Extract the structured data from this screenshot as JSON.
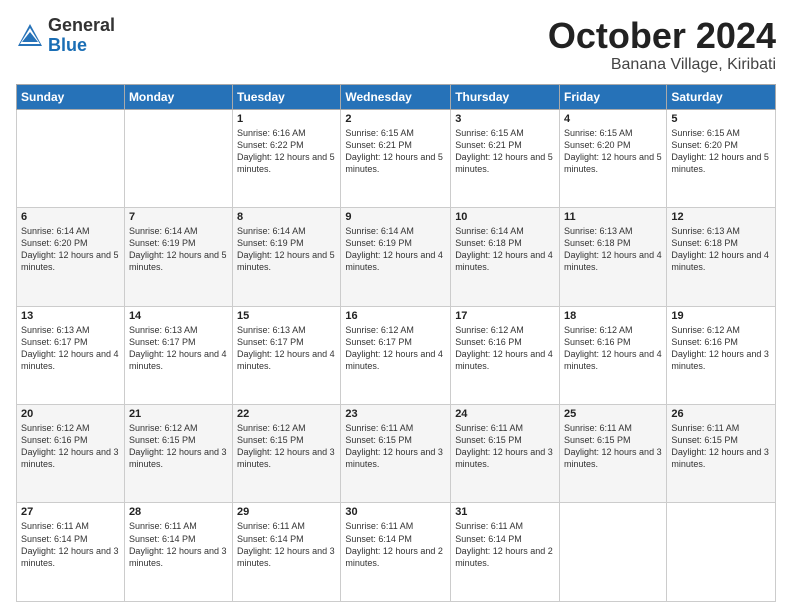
{
  "header": {
    "logo_general": "General",
    "logo_blue": "Blue",
    "month_title": "October 2024",
    "location": "Banana Village, Kiribati"
  },
  "days_of_week": [
    "Sunday",
    "Monday",
    "Tuesday",
    "Wednesday",
    "Thursday",
    "Friday",
    "Saturday"
  ],
  "weeks": [
    [
      {
        "day": "",
        "info": ""
      },
      {
        "day": "",
        "info": ""
      },
      {
        "day": "1",
        "info": "Sunrise: 6:16 AM\nSunset: 6:22 PM\nDaylight: 12 hours\nand 5 minutes."
      },
      {
        "day": "2",
        "info": "Sunrise: 6:15 AM\nSunset: 6:21 PM\nDaylight: 12 hours\nand 5 minutes."
      },
      {
        "day": "3",
        "info": "Sunrise: 6:15 AM\nSunset: 6:21 PM\nDaylight: 12 hours\nand 5 minutes."
      },
      {
        "day": "4",
        "info": "Sunrise: 6:15 AM\nSunset: 6:20 PM\nDaylight: 12 hours\nand 5 minutes."
      },
      {
        "day": "5",
        "info": "Sunrise: 6:15 AM\nSunset: 6:20 PM\nDaylight: 12 hours\nand 5 minutes."
      }
    ],
    [
      {
        "day": "6",
        "info": "Sunrise: 6:14 AM\nSunset: 6:20 PM\nDaylight: 12 hours\nand 5 minutes."
      },
      {
        "day": "7",
        "info": "Sunrise: 6:14 AM\nSunset: 6:19 PM\nDaylight: 12 hours\nand 5 minutes."
      },
      {
        "day": "8",
        "info": "Sunrise: 6:14 AM\nSunset: 6:19 PM\nDaylight: 12 hours\nand 5 minutes."
      },
      {
        "day": "9",
        "info": "Sunrise: 6:14 AM\nSunset: 6:19 PM\nDaylight: 12 hours\nand 4 minutes."
      },
      {
        "day": "10",
        "info": "Sunrise: 6:14 AM\nSunset: 6:18 PM\nDaylight: 12 hours\nand 4 minutes."
      },
      {
        "day": "11",
        "info": "Sunrise: 6:13 AM\nSunset: 6:18 PM\nDaylight: 12 hours\nand 4 minutes."
      },
      {
        "day": "12",
        "info": "Sunrise: 6:13 AM\nSunset: 6:18 PM\nDaylight: 12 hours\nand 4 minutes."
      }
    ],
    [
      {
        "day": "13",
        "info": "Sunrise: 6:13 AM\nSunset: 6:17 PM\nDaylight: 12 hours\nand 4 minutes."
      },
      {
        "day": "14",
        "info": "Sunrise: 6:13 AM\nSunset: 6:17 PM\nDaylight: 12 hours\nand 4 minutes."
      },
      {
        "day": "15",
        "info": "Sunrise: 6:13 AM\nSunset: 6:17 PM\nDaylight: 12 hours\nand 4 minutes."
      },
      {
        "day": "16",
        "info": "Sunrise: 6:12 AM\nSunset: 6:17 PM\nDaylight: 12 hours\nand 4 minutes."
      },
      {
        "day": "17",
        "info": "Sunrise: 6:12 AM\nSunset: 6:16 PM\nDaylight: 12 hours\nand 4 minutes."
      },
      {
        "day": "18",
        "info": "Sunrise: 6:12 AM\nSunset: 6:16 PM\nDaylight: 12 hours\nand 4 minutes."
      },
      {
        "day": "19",
        "info": "Sunrise: 6:12 AM\nSunset: 6:16 PM\nDaylight: 12 hours\nand 3 minutes."
      }
    ],
    [
      {
        "day": "20",
        "info": "Sunrise: 6:12 AM\nSunset: 6:16 PM\nDaylight: 12 hours\nand 3 minutes."
      },
      {
        "day": "21",
        "info": "Sunrise: 6:12 AM\nSunset: 6:15 PM\nDaylight: 12 hours\nand 3 minutes."
      },
      {
        "day": "22",
        "info": "Sunrise: 6:12 AM\nSunset: 6:15 PM\nDaylight: 12 hours\nand 3 minutes."
      },
      {
        "day": "23",
        "info": "Sunrise: 6:11 AM\nSunset: 6:15 PM\nDaylight: 12 hours\nand 3 minutes."
      },
      {
        "day": "24",
        "info": "Sunrise: 6:11 AM\nSunset: 6:15 PM\nDaylight: 12 hours\nand 3 minutes."
      },
      {
        "day": "25",
        "info": "Sunrise: 6:11 AM\nSunset: 6:15 PM\nDaylight: 12 hours\nand 3 minutes."
      },
      {
        "day": "26",
        "info": "Sunrise: 6:11 AM\nSunset: 6:15 PM\nDaylight: 12 hours\nand 3 minutes."
      }
    ],
    [
      {
        "day": "27",
        "info": "Sunrise: 6:11 AM\nSunset: 6:14 PM\nDaylight: 12 hours\nand 3 minutes."
      },
      {
        "day": "28",
        "info": "Sunrise: 6:11 AM\nSunset: 6:14 PM\nDaylight: 12 hours\nand 3 minutes."
      },
      {
        "day": "29",
        "info": "Sunrise: 6:11 AM\nSunset: 6:14 PM\nDaylight: 12 hours\nand 3 minutes."
      },
      {
        "day": "30",
        "info": "Sunrise: 6:11 AM\nSunset: 6:14 PM\nDaylight: 12 hours\nand 2 minutes."
      },
      {
        "day": "31",
        "info": "Sunrise: 6:11 AM\nSunset: 6:14 PM\nDaylight: 12 hours\nand 2 minutes."
      },
      {
        "day": "",
        "info": ""
      },
      {
        "day": "",
        "info": ""
      }
    ]
  ]
}
